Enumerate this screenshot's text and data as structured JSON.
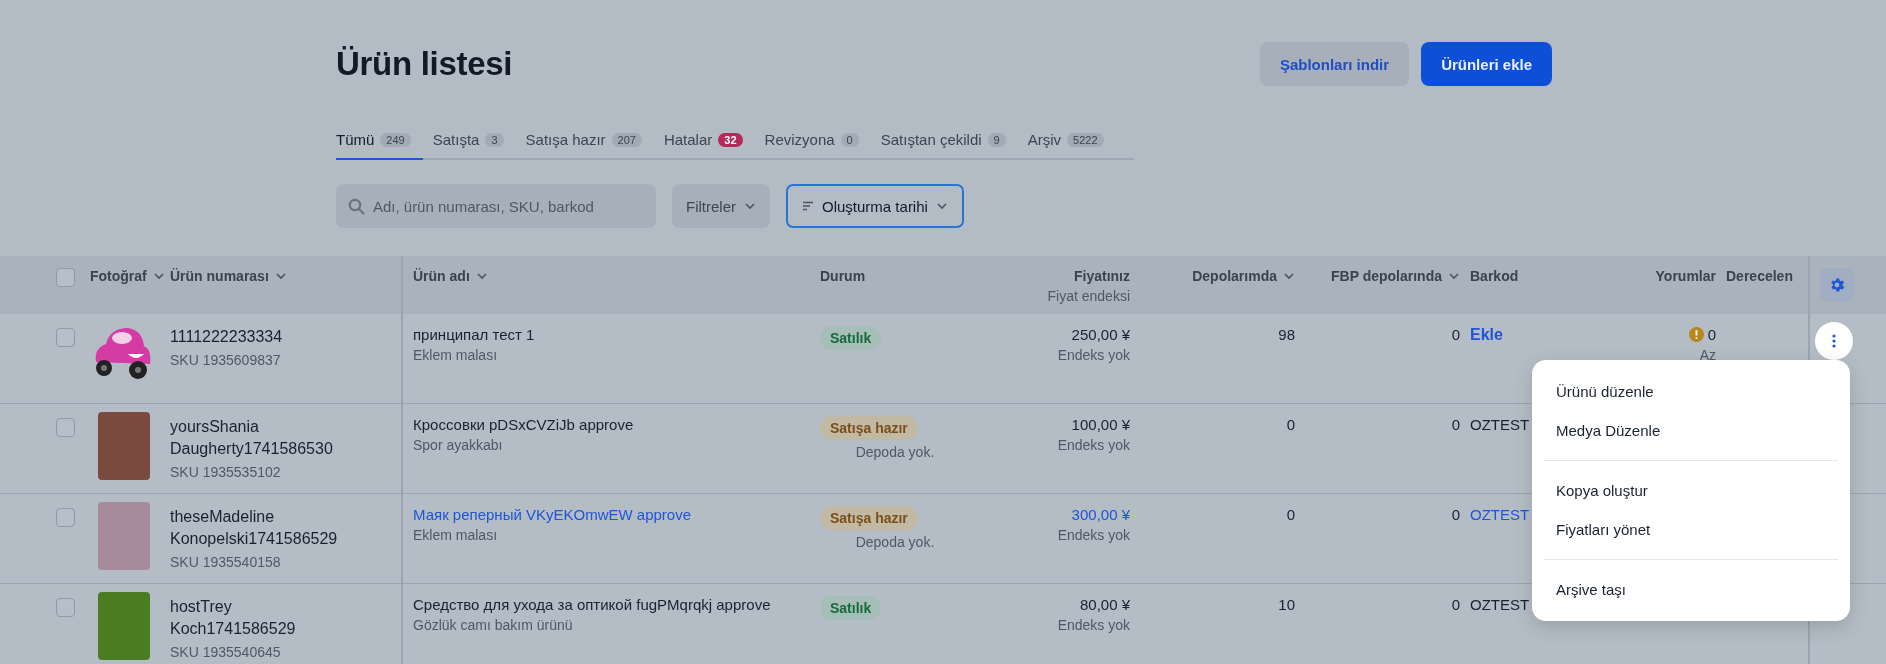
{
  "page": {
    "title": "Ürün listesi"
  },
  "actions": [
    {
      "kind": "secondary",
      "label": "Şablonları indir"
    },
    {
      "kind": "primary",
      "label": "Ürünleri ekle"
    }
  ],
  "tabs": [
    {
      "label": "Tümü",
      "count": "249",
      "selected": true,
      "alert": false
    },
    {
      "label": "Satışta",
      "count": "3",
      "selected": false,
      "alert": false
    },
    {
      "label": "Satışa hazır",
      "count": "207",
      "selected": false,
      "alert": false
    },
    {
      "label": "Hatalar",
      "count": "32",
      "selected": false,
      "alert": true
    },
    {
      "label": "Revizyona",
      "count": "0",
      "selected": false,
      "alert": false
    },
    {
      "label": "Satıştan çekildi",
      "count": "9",
      "selected": false,
      "alert": false
    },
    {
      "label": "Arşiv",
      "count": "5222",
      "selected": false,
      "alert": false
    }
  ],
  "search": {
    "placeholder": "Adı, ürün numarası, SKU, barkod"
  },
  "filter_button": "Filtreler",
  "sort_button": "Oluşturma tarihi",
  "table": {
    "select_all": {
      "checked": false
    },
    "columns": [
      {
        "label": "Fotoğraf",
        "sortable": true
      },
      {
        "label": "Ürün numarası",
        "sortable": true
      },
      {
        "label": "Ürün adı",
        "sortable": true
      },
      {
        "label": "Durum",
        "sortable": false
      },
      {
        "label": "Fiyatınız",
        "sub": "Fiyat endeksi",
        "sortable": false
      },
      {
        "label": "Depolarımda",
        "sortable": true
      },
      {
        "label": "FBP depolarında",
        "sortable": true
      },
      {
        "label": "Barkod",
        "sortable": false
      },
      {
        "label": "Yorumlar",
        "sortable": false
      },
      {
        "label": "Derecelen",
        "sortable": false
      }
    ],
    "rows": [
      {
        "checked": false,
        "photo": {
          "kind": "car"
        },
        "number_lines": [
          "1111222233334"
        ],
        "sku": "SKU 1935609837",
        "name": "принципал тест 1",
        "category": "Eklem malası",
        "linked": false,
        "status": {
          "kind": "on-sale",
          "label": "Satılık"
        },
        "price": "250,00 ¥",
        "index": "Endeks yok",
        "stock": "98",
        "fbp": "0",
        "barcode": {
          "kind": "add",
          "text": "Ekle"
        },
        "reviews": {
          "warning": true,
          "count": "0",
          "note": "Az"
        }
      },
      {
        "checked": false,
        "photo": {
          "kind": "block",
          "color": "#7a4a3e"
        },
        "number_lines": [
          "yoursShania",
          "Daugherty1741586530"
        ],
        "sku": "SKU 1935535102",
        "name": "Кроссовки pDSxCVZiJb approve",
        "category": "Spor ayakkabı",
        "linked": false,
        "status": {
          "kind": "ready",
          "label": "Satışa hazır",
          "note": "Depoda yok."
        },
        "price": "100,00 ¥",
        "index": "Endeks yok",
        "stock": "0",
        "fbp": "0",
        "barcode": {
          "kind": "code",
          "text": "OZTEST"
        }
      },
      {
        "checked": false,
        "photo": {
          "kind": "block",
          "color": "#a68b9c"
        },
        "number_lines": [
          "theseMadeline",
          "Konopelski1741586529"
        ],
        "sku": "SKU 1935540158",
        "name": "Маяк реперный VKyEKOmwEW approve",
        "category": "Eklem malası",
        "linked": true,
        "status": {
          "kind": "ready",
          "label": "Satışa hazır",
          "note": "Depoda yok."
        },
        "price": "300,00 ¥",
        "index": "Endeks yok",
        "stock": "0",
        "fbp": "0",
        "barcode": {
          "kind": "code",
          "text": "OZTEST"
        }
      },
      {
        "checked": false,
        "photo": {
          "kind": "block",
          "color": "#4a7d22"
        },
        "number_lines": [
          "hostTrey",
          "Koch1741586529"
        ],
        "sku": "SKU 1935540645",
        "name": "Средство для ухода за оптикой fugPMqrqkj approve",
        "category": "Gözlük camı bakım ürünü",
        "linked": false,
        "status": {
          "kind": "on-sale",
          "label": "Satılık"
        },
        "price": "80,00 ¥",
        "index": "Endeks yok",
        "stock": "10",
        "fbp": "0",
        "barcode": {
          "kind": "code",
          "text": "OZTEST"
        }
      }
    ]
  },
  "context_menu": {
    "groups": [
      [
        "Ürünü düzenle",
        "Medya Düzenle"
      ],
      [
        "Kopya oluştur",
        "Fiyatları yönet"
      ],
      [
        "Arşive taşı"
      ]
    ]
  }
}
